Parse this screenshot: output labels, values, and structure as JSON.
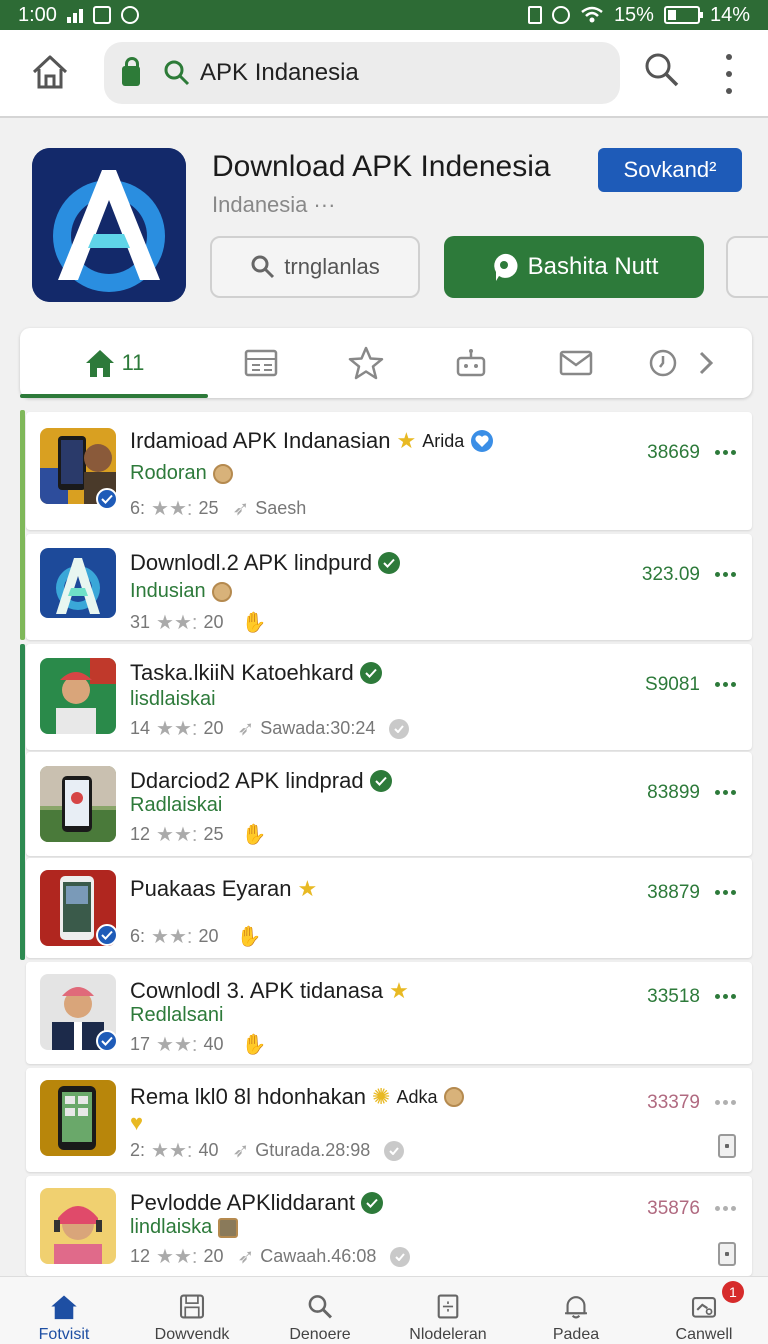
{
  "status_bar": {
    "time": "1:00",
    "signal": "15%",
    "battery": "14%"
  },
  "browser": {
    "url": "APK Indanesia"
  },
  "app": {
    "title": "Download APK Indenesia",
    "subtitle": "Indanesia",
    "subtitle_more": "···",
    "save_label": "Sovkand²",
    "search_label": "trnglanlas",
    "primary_label": "Bashita Nutt"
  },
  "tabs": [
    {
      "label": "11",
      "icon": "home-icon"
    },
    {
      "label": "",
      "icon": "news-icon"
    },
    {
      "label": "",
      "icon": "star-icon"
    },
    {
      "label": "",
      "icon": "robot-icon"
    },
    {
      "label": "",
      "icon": "mail-icon"
    },
    {
      "label": "",
      "icon": "clock-icon"
    }
  ],
  "list": [
    {
      "title": "Irdamioad APK Indanasian",
      "title_extra": "Arida",
      "subtitle": "Rodoran",
      "rating": "6:",
      "count": "25",
      "meta_extra": "Saesh",
      "price": "38669"
    },
    {
      "title": "Downlodl.2 APK lindpurd",
      "subtitle": "Indusian",
      "rating": "31",
      "count": "20",
      "price": "323.09"
    },
    {
      "title": "Taska.lkiiN Katoehkard",
      "subtitle": "lisdlaiskai",
      "rating": "14",
      "count": "20",
      "meta_extra": "Sawada:30:24",
      "price": "S9081"
    },
    {
      "title": "Ddarciod2 APK lindprad",
      "subtitle": "Radlaiskai",
      "rating": "12",
      "count": "25",
      "price": "83899"
    },
    {
      "title": "Puakaas Eyaran",
      "subtitle": "",
      "rating": "6:",
      "count": "20",
      "price": "38879"
    },
    {
      "title": "Cownlodl 3. APK tidanasa",
      "subtitle": "Redlalsani",
      "rating": "17",
      "count": "40",
      "price": "33518"
    },
    {
      "title": "Rema lkl0 8l hdonhakan",
      "title_extra": "Adka",
      "subtitle": "",
      "rating": "2:",
      "count": "40",
      "meta_extra": "Gturada.28:98",
      "price": "33379"
    },
    {
      "title": "Pevlodde APKliddarant",
      "subtitle": "lindlaiska",
      "rating": "12",
      "count": "20",
      "meta_extra": "Cawaah.46:08",
      "price": "35876"
    }
  ],
  "bottom_nav": [
    {
      "label": "Fotvisit"
    },
    {
      "label": "Dowvendk"
    },
    {
      "label": "Denoere"
    },
    {
      "label": "Nlodeleran"
    },
    {
      "label": "Padea"
    },
    {
      "label": "Canwell",
      "badge": "1"
    }
  ]
}
